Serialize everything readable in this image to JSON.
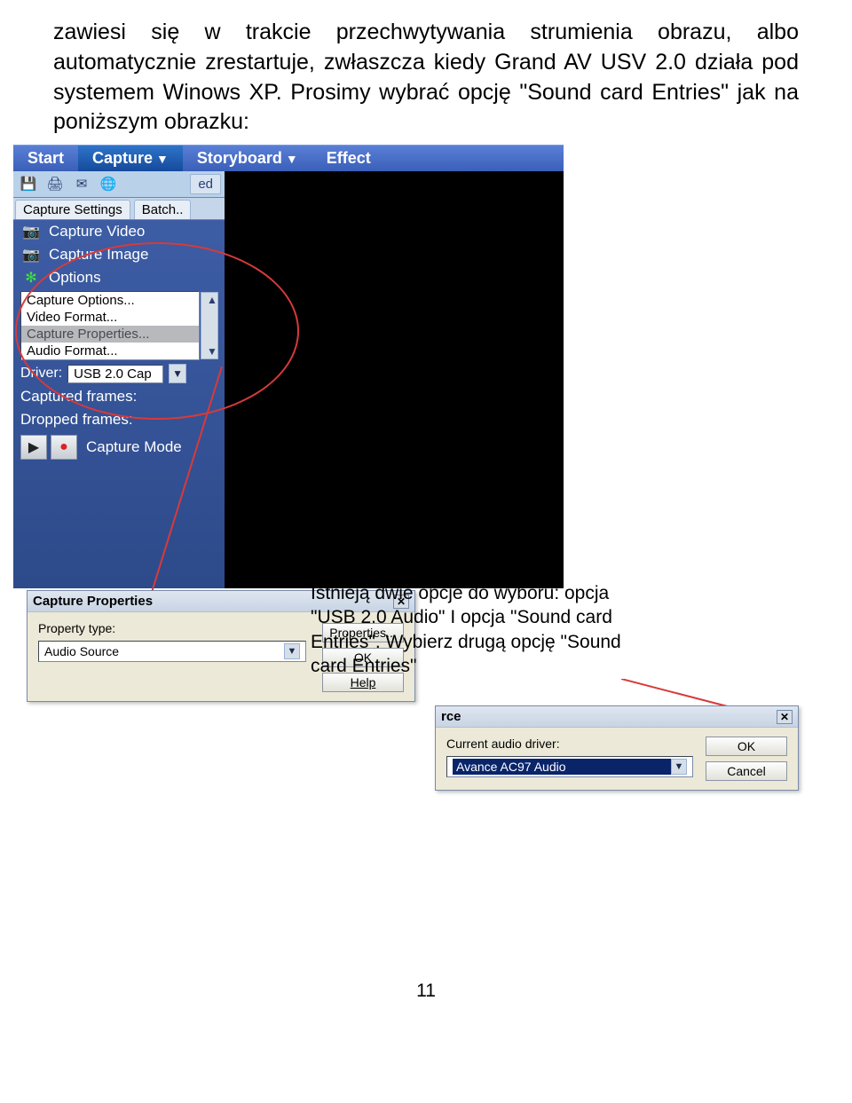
{
  "paragraph": "zawiesi się w trakcie przechwytywania strumienia obrazu, albo automatycznie zrestartuje, zwłaszcza kiedy Grand AV USV 2.0 działa pod systemem Winows XP.  Prosimy wybrać opcję \"Sound card Entries\" jak na poniższym obrazku:",
  "menubar": {
    "start": "Start",
    "capture": "Capture",
    "storyboard": "Storyboard",
    "effect": "Effect"
  },
  "sidebar": {
    "ed": "ed",
    "tab_settings": "Capture Settings",
    "tab_batch": "Batch..",
    "capture_video": "Capture Video",
    "capture_image": "Capture Image",
    "options": "Options",
    "list": {
      "capture_options": "Capture Options...",
      "video_format": "Video Format...",
      "capture_properties": "Capture Properties...",
      "audio_format": "Audio Format..."
    },
    "driver_label": "Driver:",
    "driver_value": "USB 2.0 Cap",
    "captured_frames": "Captured frames:",
    "dropped_frames": "Dropped frames:",
    "capture_mode": "Capture Mode"
  },
  "dlg1": {
    "title": "Capture Properties",
    "property_type": "Property type:",
    "combo_value": "Audio Source",
    "btn_properties": "Properties...",
    "btn_ok": "OK",
    "btn_help": "Help"
  },
  "dlg2": {
    "title": "rce",
    "current_label": "Current audio driver:",
    "combo_value": "Avance AC97 Audio",
    "btn_ok": "OK",
    "btn_cancel": "Cancel"
  },
  "callout": "Istnieją dwie opcje do wyboru: opcja \"USB 2.0 Audio\" I opcja \"Sound card Entries\". Wybierz drugą opcję \"Sound card Entries\"",
  "page_number": "11"
}
